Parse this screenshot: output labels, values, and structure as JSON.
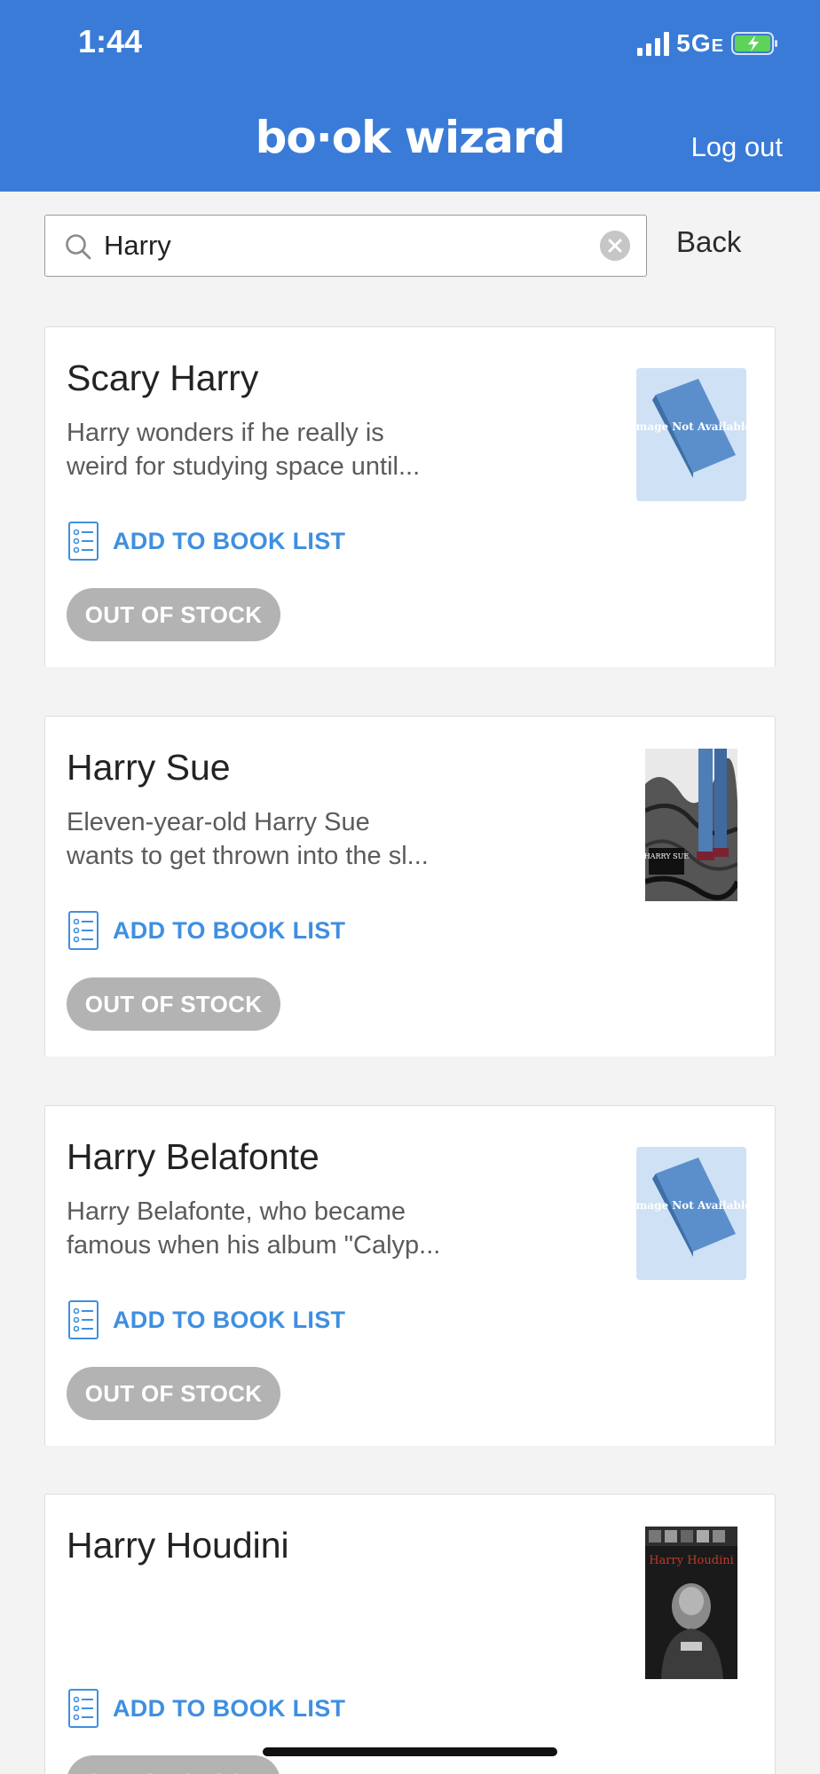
{
  "status_bar": {
    "time": "1:44",
    "network": "5G",
    "network_suffix": "E"
  },
  "header": {
    "brand": "bo·ok wizard",
    "logout_label": "Log out"
  },
  "search": {
    "value": "Harry",
    "back_label": "Back"
  },
  "colors": {
    "header": "#3a7bd8",
    "link": "#3f8fe0",
    "badge": "#b3b3b3",
    "placeholder_cover": "#cfe1f4"
  },
  "books": [
    {
      "title": "Scary Harry",
      "desc_line1": "Harry wonders if he really is",
      "desc_line2": "weird for studying space until...",
      "add_label": "ADD TO BOOK LIST",
      "stock_label": "OUT OF STOCK",
      "image_note": "Image Not Available"
    },
    {
      "title": "Harry Sue",
      "desc_line1": "Eleven-year-old Harry Sue",
      "desc_line2": "wants to get thrown into the sl...",
      "add_label": "ADD TO BOOK LIST",
      "stock_label": "OUT OF STOCK",
      "cover_text": "HARRY SUE"
    },
    {
      "title": "Harry Belafonte",
      "desc_line1": "Harry Belafonte, who became",
      "desc_line2": "famous when his album \"Calyp...",
      "add_label": "ADD TO BOOK LIST",
      "stock_label": "OUT OF STOCK",
      "image_note": "Image Not Available"
    },
    {
      "title": "Harry Houdini",
      "desc_line1": "",
      "desc_line2": "",
      "add_label": "ADD TO BOOK LIST",
      "stock_label": "OUT OF STOCK",
      "cover_text": "Harry Houdini"
    }
  ]
}
